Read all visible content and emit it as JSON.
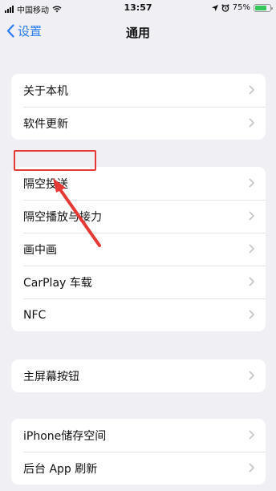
{
  "status_bar": {
    "carrier": "中国移动",
    "time": "13:57",
    "battery": "75%",
    "battery_level": 0.75,
    "icons": [
      "signal-icon",
      "wifi-icon",
      "location-icon",
      "alarm-icon",
      "battery-icon"
    ]
  },
  "nav": {
    "back_label": "设置",
    "title": "通用"
  },
  "groups": [
    [
      "关于本机",
      "软件更新"
    ],
    [
      "隔空投送",
      "隔空播放与接力",
      "画中画",
      "CarPlay 车载",
      "NFC"
    ],
    [
      "主屏幕按钮"
    ],
    [
      "iPhone储存空间",
      "后台 App 刷新"
    ]
  ],
  "annotation": {
    "highlight_color": "#e53935",
    "target": "隔空投送"
  },
  "colors": {
    "background": "#efeff4",
    "accent": "#2b7cf4",
    "battery": "#34c759"
  }
}
